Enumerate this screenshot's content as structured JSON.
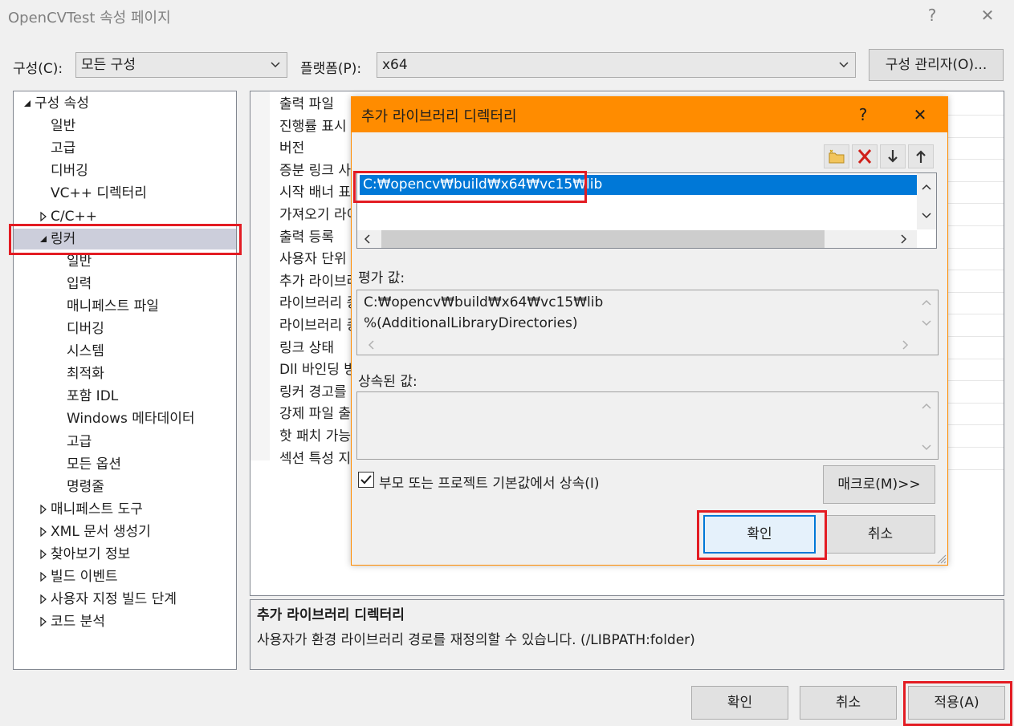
{
  "window": {
    "title": "OpenCVTest 속성 페이지",
    "help_glyph": "?",
    "close_glyph": "✕"
  },
  "config_row": {
    "config_label": "구성(C):",
    "config_value": "모든 구성",
    "platform_label": "플랫폼(P):",
    "platform_value": "x64",
    "manager_button": "구성 관리자(O)..."
  },
  "tree": {
    "items": [
      {
        "label": "구성 속성",
        "state": "expanded",
        "level": 0
      },
      {
        "label": "일반",
        "state": "none",
        "level": 1
      },
      {
        "label": "고급",
        "state": "none",
        "level": 1
      },
      {
        "label": "디버깅",
        "state": "none",
        "level": 1
      },
      {
        "label": "VC++ 디렉터리",
        "state": "none",
        "level": 1
      },
      {
        "label": "C/C++",
        "state": "collapsed",
        "level": 1
      },
      {
        "label": "링커",
        "state": "expanded",
        "level": 1,
        "selected": true
      },
      {
        "label": "일반",
        "state": "none",
        "level": 2
      },
      {
        "label": "입력",
        "state": "none",
        "level": 2
      },
      {
        "label": "매니페스트 파일",
        "state": "none",
        "level": 2
      },
      {
        "label": "디버깅",
        "state": "none",
        "level": 2
      },
      {
        "label": "시스템",
        "state": "none",
        "level": 2
      },
      {
        "label": "최적화",
        "state": "none",
        "level": 2
      },
      {
        "label": "포함 IDL",
        "state": "none",
        "level": 2
      },
      {
        "label": "Windows 메타데이터",
        "state": "none",
        "level": 2
      },
      {
        "label": "고급",
        "state": "none",
        "level": 2
      },
      {
        "label": "모든 옵션",
        "state": "none",
        "level": 2
      },
      {
        "label": "명령줄",
        "state": "none",
        "level": 2
      },
      {
        "label": "매니페스트 도구",
        "state": "collapsed",
        "level": 1
      },
      {
        "label": "XML 문서 생성기",
        "state": "collapsed",
        "level": 1
      },
      {
        "label": "찾아보기 정보",
        "state": "collapsed",
        "level": 1
      },
      {
        "label": "빌드 이벤트",
        "state": "collapsed",
        "level": 1
      },
      {
        "label": "사용자 지정 빌드 단계",
        "state": "collapsed",
        "level": 1
      },
      {
        "label": "코드 분석",
        "state": "collapsed",
        "level": 1
      }
    ]
  },
  "properties": {
    "rows": [
      "출력 파일",
      "진행률 표시",
      "버전",
      "증분 링크 사용",
      "시작 배너 표시",
      "가져오기 라이브러리",
      "출력 등록",
      "사용자 단위",
      "추가 라이브러리",
      "라이브러리 종속성",
      "라이브러리 종속성 입력",
      "링크 상태",
      "Dll 바인딩 방지",
      "링커 경고를",
      "강제 파일 출력",
      "핫 패치 가능",
      "섹션 특성 지정"
    ]
  },
  "description": {
    "title": "추가 라이브러리 디렉터리",
    "text": "사용자가 환경 라이브러리 경로를 재정의할 수 있습니다. (/LIBPATH:folder)"
  },
  "dialog": {
    "title": "추가 라이브러리 디렉터리",
    "help_glyph": "?",
    "close_glyph": "✕",
    "accent_color": "#ff8c00",
    "toolbar": {
      "new_line": "new-folder-icon",
      "delete": "delete-icon",
      "move_down": "arrow-down-icon",
      "move_up": "arrow-up-icon"
    },
    "entries": [
      "C:₩opencv₩build₩x64₩vc15₩lib"
    ],
    "evaluated_label": "평가 값:",
    "evaluated_lines": [
      "C:₩opencv₩build₩x64₩vc15₩lib",
      "%(AdditionalLibraryDirectories)"
    ],
    "inherited_label": "상속된 값:",
    "inherit_checkbox_label": "부모 또는 프로젝트 기본값에서 상속(I)",
    "inherit_checked": true,
    "macros_button": "매크로(M)>>",
    "ok_button": "확인",
    "cancel_button": "취소"
  },
  "footer": {
    "ok_button": "확인",
    "cancel_button": "취소",
    "apply_button": "적용(A)"
  },
  "highlight_color": "#e31c23",
  "selection_color": "#0078d7"
}
